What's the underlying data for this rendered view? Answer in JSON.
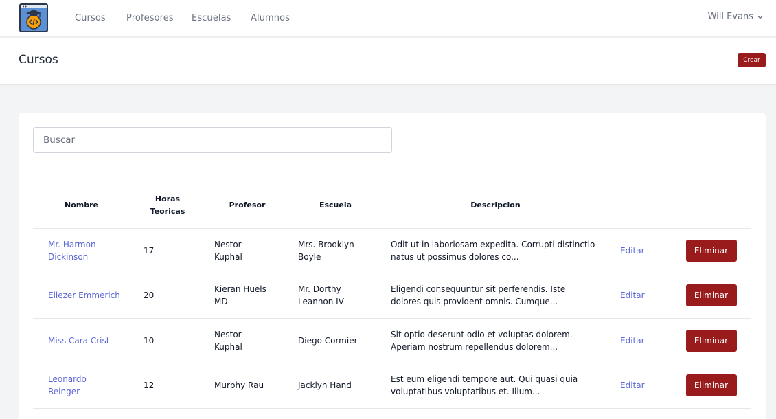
{
  "nav": {
    "links": [
      "Cursos",
      "Profesores",
      "Escuelas",
      "Alumnos"
    ],
    "user": "Will Evans"
  },
  "header": {
    "title": "Cursos",
    "create_label": "Crear"
  },
  "search": {
    "placeholder": "Buscar",
    "value": ""
  },
  "table": {
    "headers": {
      "nombre": "Nombre",
      "horas": "Horas Teoricas",
      "profesor": "Profesor",
      "escuela": "Escuela",
      "descripcion": "Descripcion"
    },
    "rows": [
      {
        "nombre": "Mr. Harmon Dickinson",
        "horas": "17",
        "profesor": "Nestor Kuphal",
        "escuela": "Mrs. Brooklyn Boyle",
        "descripcion": "Odit ut in laboriosam expedita. Corrupti distinctio natus ut possimus dolores co...",
        "edit": "Editar",
        "delete": "Eliminar"
      },
      {
        "nombre": "Eliezer Emmerich",
        "horas": "20",
        "profesor": "Kieran Huels MD",
        "escuela": "Mr. Dorthy Leannon IV",
        "descripcion": "Eligendi consequuntur sit perferendis. Iste dolores quis provident omnis. Cumque...",
        "edit": "Editar",
        "delete": "Eliminar"
      },
      {
        "nombre": "Miss Cara Crist",
        "horas": "10",
        "profesor": "Nestor Kuphal",
        "escuela": "Diego Cormier",
        "descripcion": "Sit optio deserunt odio et voluptas dolorem. Aperiam nostrum repellendus dolorem...",
        "edit": "Editar",
        "delete": "Eliminar"
      },
      {
        "nombre": "Leonardo Reinger",
        "horas": "12",
        "profesor": "Murphy Rau",
        "escuela": "Jacklyn Hand",
        "descripcion": "Est eum eligendi tempore aut. Qui quasi quia voluptatibus voluptatibus et. Illum...",
        "edit": "Editar",
        "delete": "Eliminar"
      }
    ]
  },
  "colors": {
    "accent": "#991b1b",
    "link": "#5a67d8",
    "logo_bg": "#5b8fd6",
    "logo_medal": "#f59e0b"
  },
  "icons": {
    "logo": "graduation-cap-code-logo",
    "user_menu": "chevron-down-icon"
  }
}
